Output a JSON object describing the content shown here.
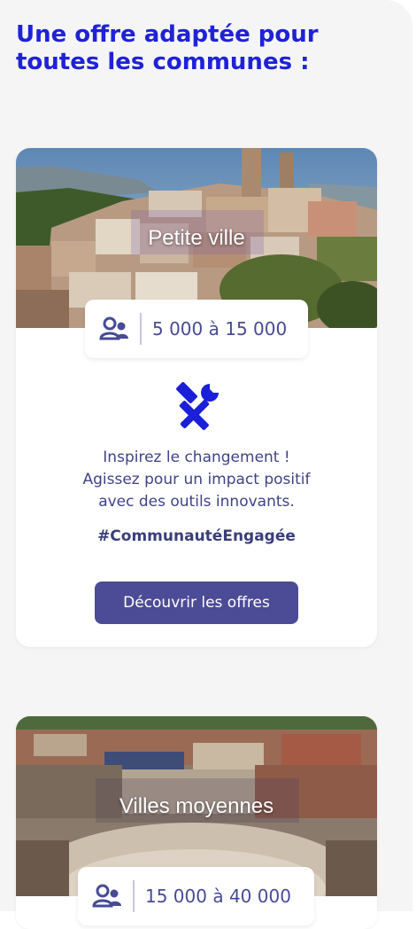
{
  "section": {
    "heading": "Une offre adaptée pour toutes les communes :"
  },
  "cards": [
    {
      "title": "Petite ville",
      "population": "5 000 à 15 000",
      "description": [
        "Inspirez le changement !",
        "Agissez pour un impact positif",
        "avec des outils innovants."
      ],
      "hashtag": "#CommunautéEngagée",
      "button_label": "Découvrir les offres"
    },
    {
      "title": "Villes moyennes",
      "population": "15 000 à 40 000"
    }
  ],
  "colors": {
    "heading": "#1f22d6",
    "accent_icon": "#1b1fd8",
    "button": "#4c4b96",
    "text": "#3f4386"
  },
  "icons": {
    "population": "users-icon",
    "tools": "tools-icon"
  }
}
